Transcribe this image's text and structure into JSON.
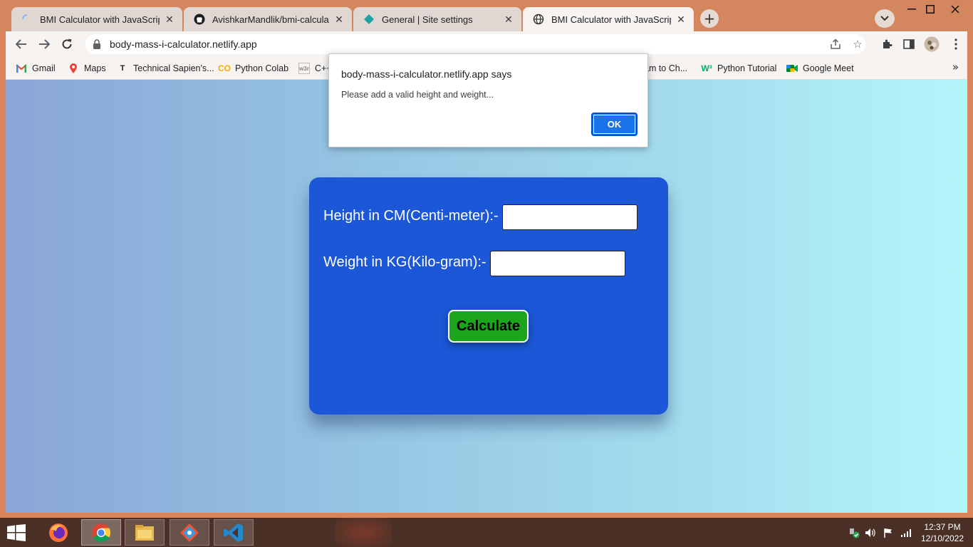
{
  "browser": {
    "tabs": [
      {
        "title": "BMI Calculator with JavaScript",
        "favicon": "loading-spinner-icon"
      },
      {
        "title": "AvishkarMandlik/bmi-calculator-j",
        "favicon": "github-icon"
      },
      {
        "title": "General | Site settings",
        "favicon": "netlify-icon"
      },
      {
        "title": "BMI Calculator with JavaScript",
        "favicon": "globe-icon"
      }
    ],
    "active_tab_index": 3,
    "url": "body-mass-i-calculator.netlify.app",
    "bookmarks": [
      {
        "label": "Gmail",
        "icon": "gmail-icon"
      },
      {
        "label": "Maps",
        "icon": "maps-icon"
      },
      {
        "label": "Technical Sapien's...",
        "icon": "bookmark-t-icon"
      },
      {
        "label": "Python Colab",
        "icon": "colab-icon"
      },
      {
        "label": "C++",
        "icon": "w3schools-icon"
      },
      {
        "label": "am to Ch...",
        "icon": ""
      },
      {
        "label": "Python Tutorial",
        "icon": "w3-icon"
      },
      {
        "label": "Google Meet",
        "icon": "meet-icon"
      }
    ]
  },
  "dialog": {
    "title": "body-mass-i-calculator.netlify.app says",
    "message": "Please add a valid height and weight...",
    "ok_label": "OK"
  },
  "form": {
    "height_label": "Height in CM(Centi-meter):-",
    "height_value": "",
    "weight_label": "Weight in KG(Kilo-gram):-",
    "weight_value": "",
    "calculate_label": "Calculate"
  },
  "taskbar": {
    "time": "12:37 PM",
    "date": "12/10/2022"
  },
  "colors": {
    "card": "#1b57d6",
    "button": "#1aa51a",
    "dialog_ok": "#1a73e8"
  }
}
